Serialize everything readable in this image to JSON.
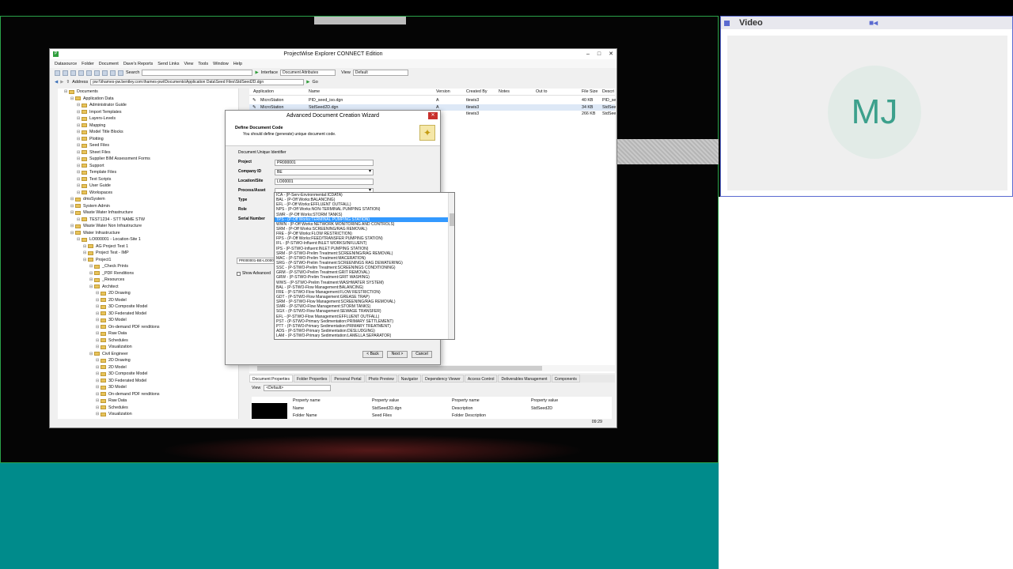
{
  "video_panel": {
    "title": "Video",
    "initials": "MJ"
  },
  "app": {
    "title": "ProjectWise Explorer CONNECT Edition",
    "menu": [
      "Datasource",
      "Folder",
      "Document",
      "Dave's Reports",
      "Send Links",
      "View",
      "Tools",
      "Window",
      "Help"
    ],
    "toolbar": {
      "search_label": "Search",
      "interface_label": "Interface",
      "interface_value": "Document Attributes",
      "view_label": "View",
      "view_value": "Default"
    },
    "address": {
      "label": "Address",
      "value": "pw:\\\\thames-pw.bentley.com:thames-pwi\\Documents\\Application Data\\Seed Files\\StdSeed2D.dgn",
      "go": "Go"
    },
    "tree": [
      "Documents",
      "Application Data",
      "Administrator Guide",
      "Import Templates",
      "Layers-Levels",
      "Mapping",
      "Model Title Blocks",
      "Plotting",
      "Seed Files",
      "Sheet Files",
      "Supplier BIM Assessment Forms",
      "Support",
      "Template Files",
      "Text Scripts",
      "User Guide",
      "Workspaces",
      "dmsSystem",
      "System Admin",
      "Waste Water Infrastructure",
      "TEST1234 - STT NAME STW",
      "Waste Water Non Infrastructure",
      "Water Infrastructure",
      "LO000001 - Location-Site 1",
      "AG Project Test 1",
      "Project Test - IMP",
      "Project1",
      "_Check Prints",
      "_PDF Renditions",
      "_Resources",
      "Architect",
      "2D Drawing",
      "2D Model",
      "3D Composite Model",
      "3D Federated Model",
      "3D Model",
      "On-demand PDF renditions",
      "Raw Data",
      "Schedules",
      "Visualization",
      "Civil Engineer",
      "2D Drawing",
      "2D Model",
      "3D Composite Model",
      "3D Federated Model",
      "3D Model",
      "On-demand PDF renditions",
      "Raw Data",
      "Schedules",
      "Visualization"
    ],
    "doclist": {
      "headers": [
        "Application",
        "Name",
        "Version",
        "Created By",
        "Notes",
        "Out to",
        "File Size",
        "Descri"
      ],
      "rows": [
        [
          "MicroStation",
          "PID_seed_iso.dgn",
          "A",
          "tlewis3",
          "",
          "",
          "40 KB",
          "PID_se"
        ],
        [
          "MicroStation",
          "StdSeed2D.dgn",
          "A",
          "tlewis3",
          "",
          "",
          "34 KB",
          "StdSee"
        ],
        [
          "",
          "",
          "A",
          "tlewis3",
          "",
          "",
          "266 KB",
          "StdSee"
        ]
      ]
    },
    "bottom_tabs": [
      "Document Properties",
      "Folder Properties",
      "Personal Portal",
      "Photo Preview",
      "Navigator",
      "Dependency Viewer",
      "Access Control",
      "Deliverables Management",
      "Components"
    ],
    "view_label": "View",
    "view_value": "<Default>",
    "props": {
      "headers": [
        "Property name",
        "Property value",
        "Property name",
        "Property value"
      ],
      "row1": [
        "Name",
        "StdSeed2D.dgn",
        "Description",
        "StdSeed2D"
      ],
      "row2": [
        "Folder Name",
        "Seed Files",
        "Folder Description",
        ""
      ]
    },
    "clock": "09:29"
  },
  "wizard": {
    "title": "Advanced Document Creation Wizard",
    "heading": "Define Document Code",
    "subheading": "You should define (generate) unique document code.",
    "group_label": "Document Unique Identifier",
    "fields": [
      {
        "label": "Project",
        "value": "PR000001"
      },
      {
        "label": "Company ID",
        "value": "BE"
      },
      {
        "label": "Location/Site",
        "value": "LO00001"
      },
      {
        "label": "Process/Asset",
        "value": ""
      },
      {
        "label": "Type",
        "value": ""
      },
      {
        "label": "Role",
        "value": ""
      },
      {
        "label": "Serial Number",
        "value": ""
      }
    ],
    "code_preview": "PR000001-BE-LO000",
    "show_advanced": "Show Advanced",
    "buttons": {
      "back": "< Back",
      "next": "Next >",
      "cancel": "Cancel"
    }
  },
  "dropdown": {
    "selected_index": 5,
    "items": [
      "ICA - (P-Serv-Environmental:ICDATA)",
      "BAL - (P-Off Works:BALANCING)",
      "EFL - (P-Off Works:EFFLUENT OUTFALL)",
      "NPS - (P-Off Works:NON-TERMINAL PUMPING STATION)",
      "SWR - (P-Off Works:STORM TANKS)",
      "TPS - (P-Off Works:TERMINAL PUMPING STATION)",
      "WWN - (P-Off Works:NETWORK MONITORING AND CONTROLS)",
      "SRM - (P-Off Works:SCREENING/RAG REMOVAL)",
      "FRE - (P-Off Works:FLOW RESTRICTION)",
      "FPS - (P-Off Works:FEED/TRANSFER PUMPING STATION)",
      "IFL - (P-STWO-Influent:INLET WORKS/INFLUENT)",
      "IPS - (P-STWO-Influent:INLET PUMPING STATION)",
      "SRM - (P-STWO-Prelim Treatment:SCREENING/RAG REMOVAL)",
      "MAC - (P-STWO-Prelim Treatment:MACERATION)",
      "SRG - (P-STWO-Prelim Treatment:SCREENINGS RAG DEWATERING)",
      "SSC - (P-STWO-Prelim Treatment:SCREENINGS CONDITIONING)",
      "GRM - (P-STWO-Prelim Treatment:GRIT REMOVAL)",
      "GRW - (P-STWO-Prelim Treatment:GRIT WASHING)",
      "WWS - (P-STWO-Prelim Treatment:WASHWATER SYSTEM)",
      "BAL - (P-STWO-Flow Management:BALANCING)",
      "FRE - (P-STWO-Flow Management:FLOW RESTRICTION)",
      "GDT - (P-STWO-Flow Management:GREASE TRAP)",
      "SRM - (P-STWO-Flow Management:SCREENING/RAG REMOVAL)",
      "SWR - (P-STWO-Flow Management:STORM TANKS)",
      "SGX - (P-STWO-Flow Management:SEWAGE TRANSFER)",
      "EFL - (P-STWO-Flow Management:EFFLUENT OUTFALL)",
      "PST - (P-STWO-Primary Sedimentation:PRIMARY SETTLEMENT)",
      "PTT - (P-STWO-Primary Sedimentation:PRIMARY TREATMENT)",
      "ADS - (P-STWO-Primary Sedimentation:DESLUDGING)",
      "LAM - (P-STWO-Primary Sedimentation:LAMELLA SEPARATOR)"
    ]
  }
}
